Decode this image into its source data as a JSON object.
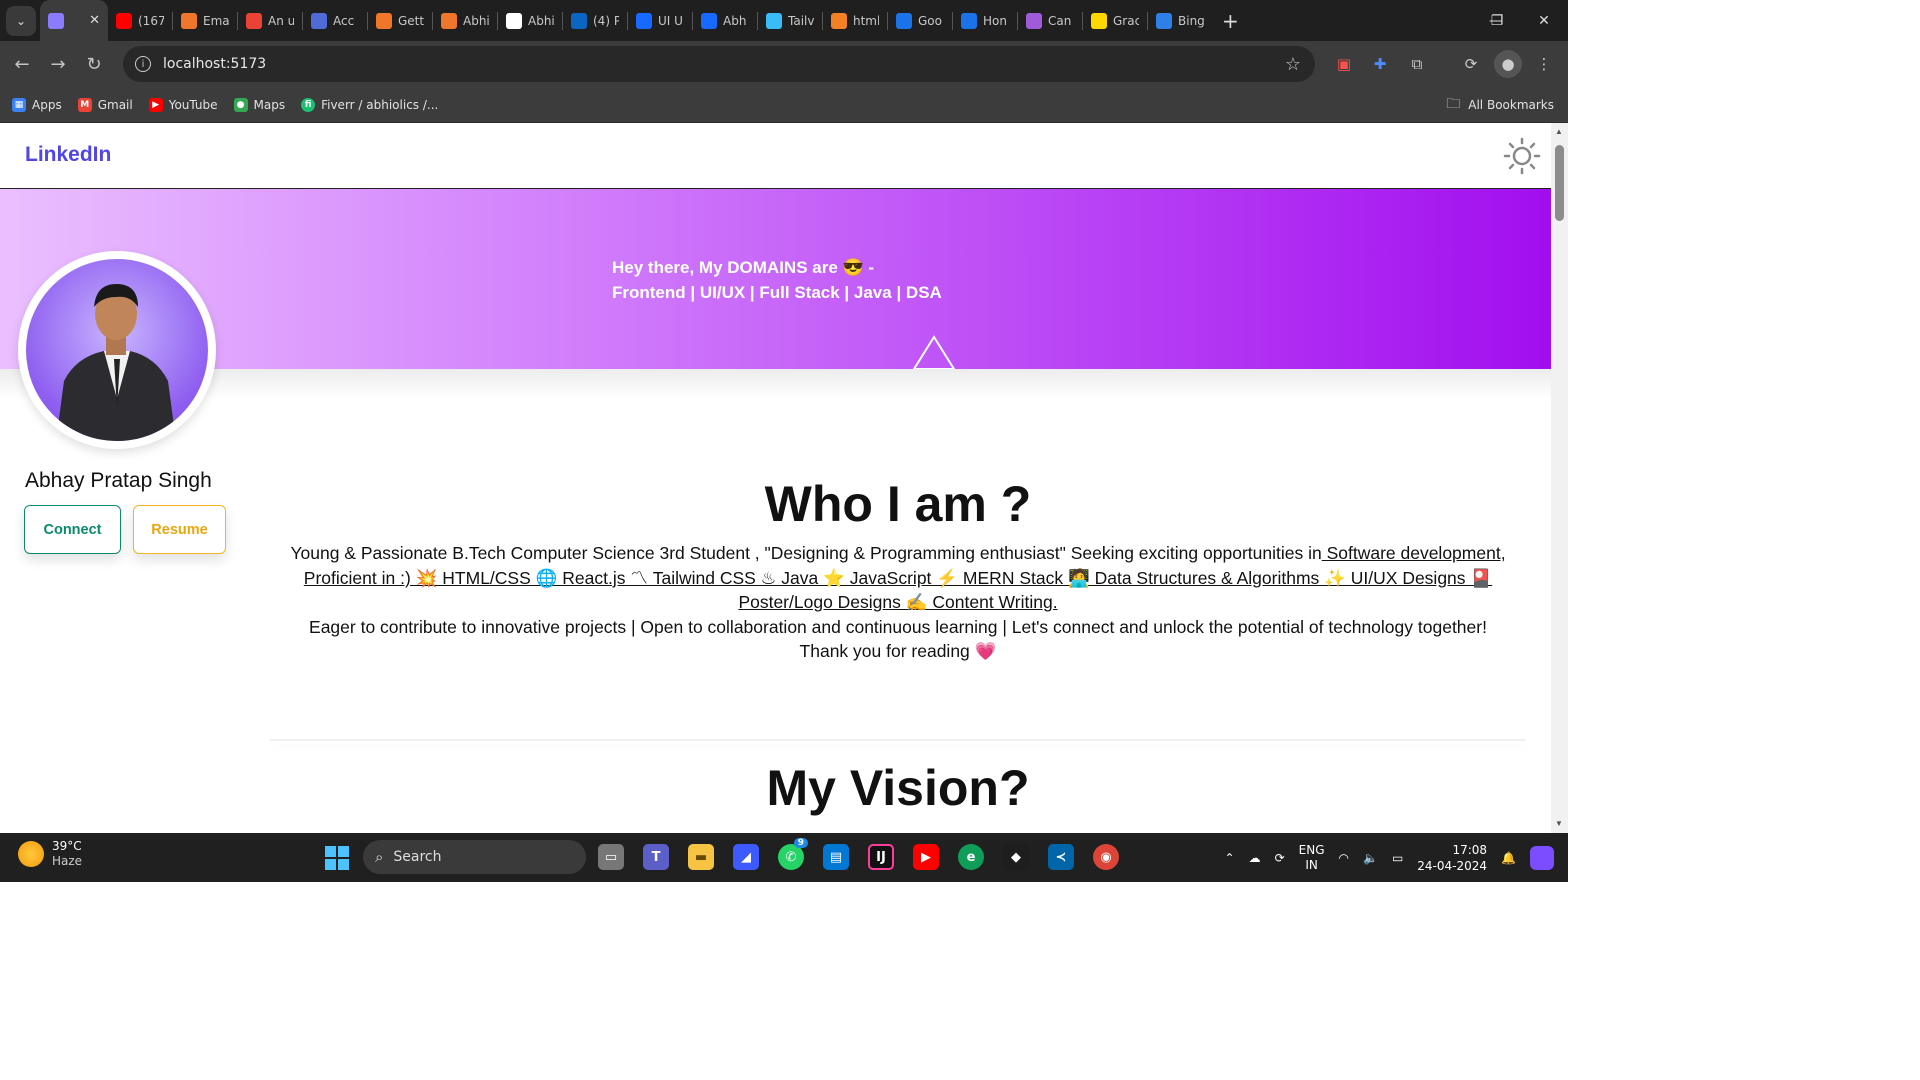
{
  "browser": {
    "tabs": [
      {
        "label": "",
        "color": "#8a7bff",
        "active": true
      },
      {
        "label": "(167",
        "color": "#ff0000"
      },
      {
        "label": "Ema",
        "color": "#f0762c"
      },
      {
        "label": "An u",
        "color": "#ea4335"
      },
      {
        "label": "Acc",
        "color": "#4f6bd6"
      },
      {
        "label": "Gett",
        "color": "#f0762c"
      },
      {
        "label": "Abhi",
        "color": "#f0762c"
      },
      {
        "label": "Abhi",
        "color": "#ffffff"
      },
      {
        "label": "(4) P",
        "color": "#0a66c2"
      },
      {
        "label": "UI U",
        "color": "#1769ff"
      },
      {
        "label": "Abh",
        "color": "#1769ff"
      },
      {
        "label": "Tailv",
        "color": "#38bdf8"
      },
      {
        "label": "html",
        "color": "#f48024"
      },
      {
        "label": "Goo",
        "color": "#1a73e8"
      },
      {
        "label": "Hon",
        "color": "#1a73e8"
      },
      {
        "label": "Can",
        "color": "#a05cd8"
      },
      {
        "label": "Grac",
        "color": "#ffd700"
      },
      {
        "label": "Bing",
        "color": "#2f7fe8"
      }
    ],
    "url": "localhost:5173",
    "bookmarks": [
      "Apps",
      "Gmail",
      "YouTube",
      "Maps",
      "Fiverr / abhiolics /..."
    ],
    "all_bookmarks": "All Bookmarks"
  },
  "app": {
    "brand": "LinkedIn",
    "hero_line1": "Hey there, My DOMAINS are 😎 -",
    "hero_line2": "Frontend | UI/UX | Full Stack | Java | DSA",
    "profile_name": "Abhay Pratap Singh",
    "connect_label": "Connect",
    "resume_label": "Resume",
    "who_title": "Who I am ?",
    "about_intro": "Young & Passionate B.Tech Computer Science 3rd Student , \"Designing & Programming enthusiast\" Seeking exciting opportunities in",
    "about_skills": " Software development, Proficient in :) 💥 HTML/CSS 🌐 React.js 〽 Tailwind CSS ♨ Java ⭐ JavaScript ⚡ MERN Stack 🧑‍💻 Data Structures & Algorithms ✨ UI/UX Designs 🎴 Poster/Logo Designs ✍ Content Writing.",
    "about_line2": "Eager to contribute to innovative projects | Open to collaboration and continuous learning | Let's connect and unlock the potential of technology together!",
    "about_line3": "Thank you for reading 💗",
    "vision_title": "My Vision?"
  },
  "taskbar": {
    "temp": "39°C",
    "weather": "Haze",
    "search": "Search",
    "whatsapp_badge": "9",
    "lang1": "ENG",
    "lang2": "IN",
    "time": "17:08",
    "date": "24-04-2024"
  }
}
